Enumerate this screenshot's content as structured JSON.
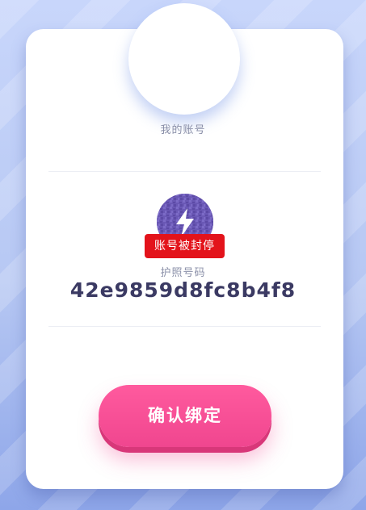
{
  "account": {
    "label": "我的账号"
  },
  "passport": {
    "icon": "lightning-bolt-icon",
    "status_badge": "账号被封停",
    "label": "护照号码",
    "number": "42e9859d8fc8b4f8"
  },
  "actions": {
    "confirm_bind_label": "确认绑定"
  },
  "colors": {
    "badge_bg": "#e3131b",
    "button_bg": "#f0468f",
    "icon_bg": "#6d5bb8",
    "title_text": "#3b3a63"
  }
}
